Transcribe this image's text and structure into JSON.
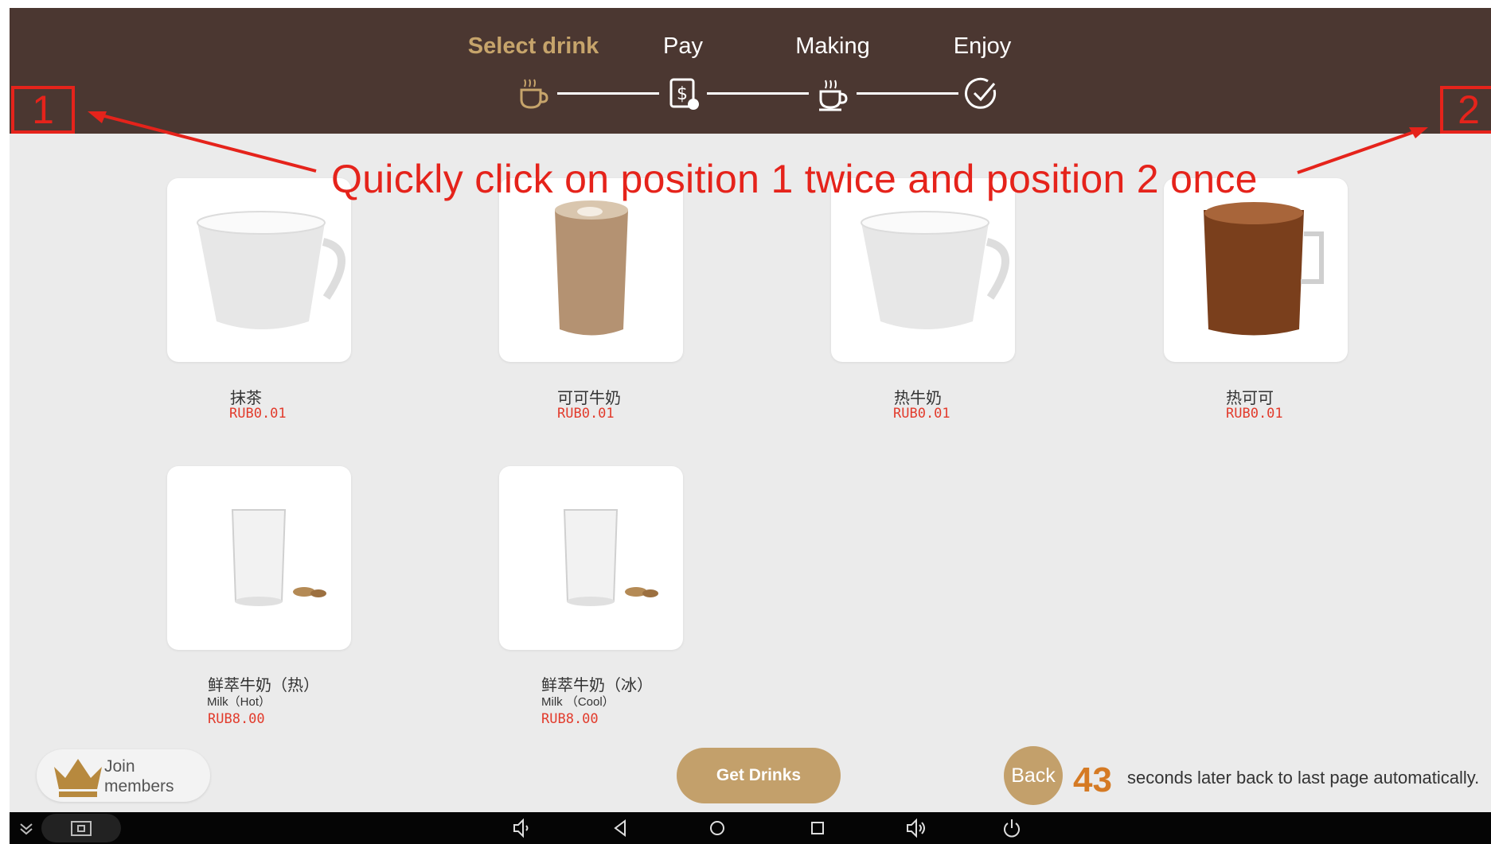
{
  "steps": [
    {
      "label": "Select drink",
      "active": true,
      "icon": "coffee-cup-icon"
    },
    {
      "label": "Pay",
      "active": false,
      "icon": "payment-icon"
    },
    {
      "label": "Making",
      "active": false,
      "icon": "steaming-cup-icon"
    },
    {
      "label": "Enjoy",
      "active": false,
      "icon": "checkmark-icon"
    }
  ],
  "annotation": {
    "marker_1": "1",
    "marker_2": "2",
    "instruction": "Quickly click on position 1 twice and position 2 once",
    "color": "#e5231b"
  },
  "products": [
    {
      "name": "抹茶",
      "price": "RUB0.01",
      "image": "white-mug-milk"
    },
    {
      "name": "可可牛奶",
      "price": "RUB0.01",
      "image": "tall-cup-cocoa-milk"
    },
    {
      "name": "热牛奶",
      "price": "RUB0.01",
      "image": "white-mug-milk"
    },
    {
      "name": "热可可",
      "price": "RUB0.01",
      "image": "glass-mug-hot-cocoa"
    },
    {
      "name": "鲜萃牛奶（热）",
      "subtitle": "Milk（Hot）",
      "price": "RUB8.00",
      "image": "glass-of-milk"
    },
    {
      "name": "鲜萃牛奶（冰）",
      "subtitle": "Milk （Cool）",
      "price": "RUB8.00",
      "image": "glass-of-milk"
    }
  ],
  "footer": {
    "join_label": "Join members",
    "get_drinks_label": "Get Drinks",
    "back_label": "Back",
    "countdown": "43",
    "countdown_message": "seconds later back to last page automatically."
  },
  "colors": {
    "header_bg": "#4b3731",
    "accent_gold": "#c3a06b",
    "price_red": "#e23b2c",
    "countdown_orange": "#d57a24"
  }
}
